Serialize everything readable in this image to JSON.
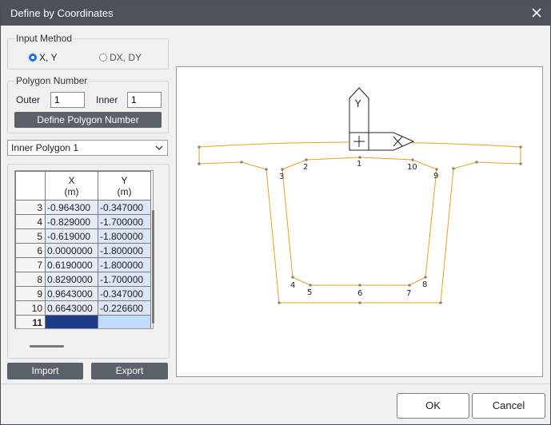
{
  "window": {
    "title": "Define by Coordinates"
  },
  "input_method": {
    "legend": "Input Method",
    "options": [
      "X, Y",
      "DX, DY"
    ],
    "selected": "X, Y"
  },
  "polygon_number": {
    "legend": "Polygon Number",
    "outer_label": "Outer",
    "outer_value": "1",
    "inner_label": "Inner",
    "inner_value": "1",
    "define_button": "Define Polygon Number"
  },
  "polygon_select": {
    "value": "Inner Polygon 1"
  },
  "table": {
    "headers": {
      "x": "X",
      "x_unit": "(m)",
      "y": "Y",
      "y_unit": "(m)"
    },
    "rows": [
      {
        "n": "3",
        "x": "-0.964300",
        "y": "-0.347000"
      },
      {
        "n": "4",
        "x": "-0.829000",
        "y": "-1.700000"
      },
      {
        "n": "5",
        "x": "-0.619000",
        "y": "-1.800000"
      },
      {
        "n": "6",
        "x": "0.0000000",
        "y": "-1.800000"
      },
      {
        "n": "7",
        "x": "0.6190000",
        "y": "-1.800000"
      },
      {
        "n": "8",
        "x": "0.8290000",
        "y": "-1.700000"
      },
      {
        "n": "9",
        "x": "0.9643000",
        "y": "-0.347000"
      },
      {
        "n": "10",
        "x": "0.6643000",
        "y": "-0.226600"
      },
      {
        "n": "11",
        "x": "",
        "y": ""
      }
    ]
  },
  "buttons": {
    "import": "Import",
    "export": "Export",
    "ok": "OK",
    "cancel": "Cancel"
  },
  "preview": {
    "axis_y_label": "Y",
    "vertex_labels": [
      "1",
      "2",
      "3",
      "4",
      "5",
      "6",
      "7",
      "8",
      "9",
      "10"
    ],
    "outline_color": "#e8a317",
    "vertex_color": "#888888"
  }
}
